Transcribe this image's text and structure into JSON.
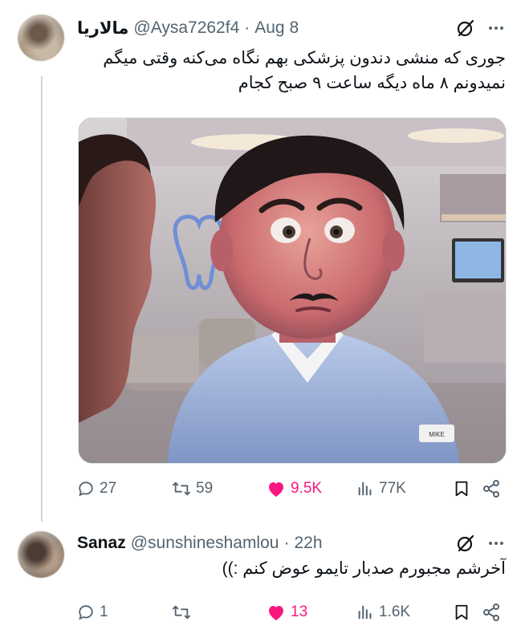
{
  "tweet": {
    "display_name": "مالاریا",
    "handle": "@Aysa7262f4",
    "separator": "·",
    "date": "Aug 8",
    "text_line1": "جوری که منشی دندون پزشکی بهم نگاه می‌کنه وقتی میگم",
    "text_line2": "نمیدونم ۸ ماه دیگه ساعت ۹ صبح کجام",
    "replies": "27",
    "reposts": "59",
    "likes": "9.5K",
    "views": "77K",
    "like_color": "#f91880"
  },
  "reply": {
    "display_name": "Sanaz",
    "handle": "@sunshineshamlou",
    "separator": "·",
    "date": "22h",
    "text": "آخرشم مجبورم صدبار تایمو عوض کنم :))",
    "replies": "1",
    "reposts": "",
    "likes": "13",
    "views": "1.6K",
    "like_color": "#f91880"
  },
  "icons": [
    "grok-icon",
    "more-icon",
    "reply-icon",
    "repost-icon",
    "like-icon",
    "views-icon",
    "bookmark-icon",
    "share-icon"
  ],
  "colors": {
    "text": "#0f1419",
    "muted": "#536471",
    "thread_line": "#cfd9de"
  }
}
